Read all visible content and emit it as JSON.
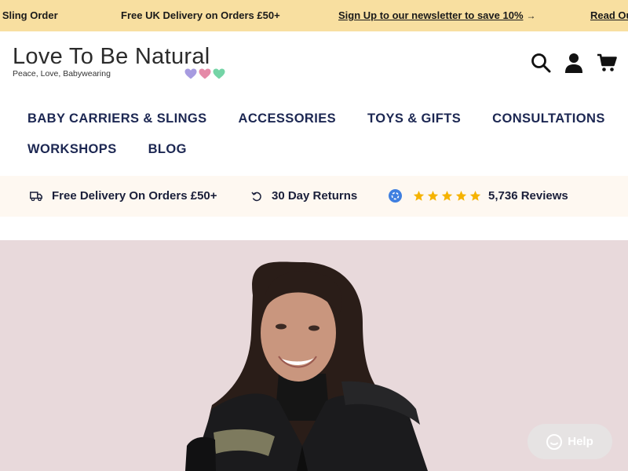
{
  "announcement": {
    "item1": "y Sling Order",
    "item2": "Free UK Delivery on Orders £50+",
    "item3": "Sign Up to our newsletter to save 10%",
    "item3_arrow": "→",
    "item4": "Read Ou"
  },
  "logo": {
    "name": "Love To Be Natural",
    "tagline": "Peace, Love, Babywearing",
    "heart_colors": [
      "#a79be0",
      "#e58aa8",
      "#74d4a6"
    ]
  },
  "header_icons": [
    "search-icon",
    "account-icon",
    "cart-icon"
  ],
  "nav": {
    "row1": [
      "BABY CARRIERS & SLINGS",
      "ACCESSORIES",
      "TOYS & GIFTS",
      "CONSULTATIONS"
    ],
    "row2": [
      "WORKSHOPS",
      "BLOG"
    ]
  },
  "usp": {
    "delivery": "Free Delivery On Orders £50+",
    "returns": "30 Day Returns",
    "rating_stars": 5,
    "reviews": "5,736 Reviews"
  },
  "help": {
    "label": "Help"
  },
  "colors": {
    "announcement_bg": "#f8dfa0",
    "nav_text": "#1c2752",
    "usp_bg": "#fef8f1",
    "star": "#f5b301",
    "hero_bg": "#e8d9db"
  }
}
